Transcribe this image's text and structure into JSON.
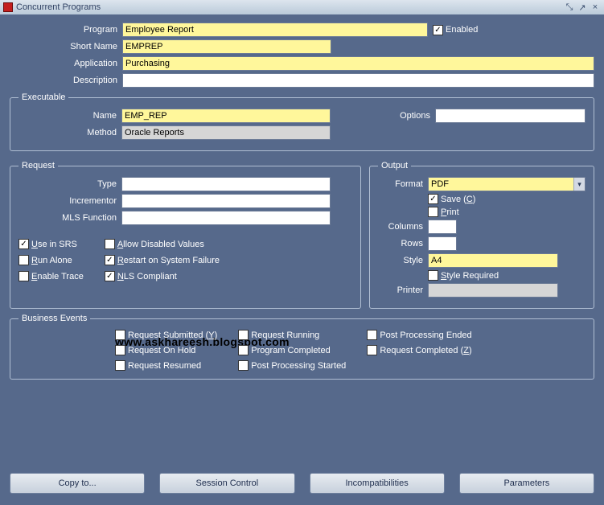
{
  "window": {
    "title": "Concurrent Programs"
  },
  "labels": {
    "program": "Program",
    "short_name": "Short Name",
    "application": "Application",
    "description": "Description",
    "enabled": "Enabled"
  },
  "program": {
    "name": "Employee Report",
    "short_name": "EMPREP",
    "application": "Purchasing",
    "description": "",
    "enabled": true
  },
  "executable": {
    "legend": "Executable",
    "labels": {
      "name": "Name",
      "method": "Method",
      "options": "Options"
    },
    "name": "EMP_REP",
    "method": "Oracle Reports",
    "options": ""
  },
  "request": {
    "legend": "Request",
    "labels": {
      "type": "Type",
      "incrementor": "Incrementor",
      "mls": "MLS Function"
    },
    "type": "",
    "incrementor": "",
    "mls": "",
    "checks": {
      "use_in_srs": {
        "label_pre": "U",
        "label": "se in SRS",
        "checked": true
      },
      "run_alone": {
        "label_pre": "R",
        "label": "un Alone",
        "checked": false
      },
      "enable_trace": {
        "label_pre": "E",
        "label": "nable Trace",
        "checked": false
      },
      "allow_disabled": {
        "label_pre": "A",
        "label": "llow Disabled Values",
        "checked": false
      },
      "restart": {
        "label_pre": "R",
        "label": "estart on System Failure",
        "checked": true
      },
      "nls": {
        "label_pre": "N",
        "label": "LS Compliant",
        "checked": true
      }
    }
  },
  "output": {
    "legend": "Output",
    "labels": {
      "format": "Format",
      "columns": "Columns",
      "rows": "Rows",
      "style": "Style",
      "printer": "Printer"
    },
    "format": "PDF",
    "save_label_pre": "Save (",
    "save_label_u": "C",
    "save_label_post": ")",
    "save": true,
    "print_pre": "P",
    "print_label": "rint",
    "print": false,
    "columns": "",
    "rows": "",
    "style": "A4",
    "style_required_pre": "S",
    "style_required_label": "tyle Required",
    "style_required": false,
    "printer": ""
  },
  "biz": {
    "legend": "Business Events",
    "items": {
      "submitted": {
        "label": "Request Submitted (",
        "u": "Y",
        "post": ")",
        "checked": false
      },
      "onhold": {
        "label": "Request On Hold",
        "checked": false
      },
      "resumed": {
        "label": "Request Resumed",
        "checked": false
      },
      "running": {
        "label": "Request Running",
        "checked": false
      },
      "prog_completed": {
        "label": "Program Completed",
        "checked": false
      },
      "post_started": {
        "label": "Post Processing Started",
        "checked": false
      },
      "post_ended": {
        "label": "Post Processing Ended",
        "checked": false
      },
      "req_completed": {
        "label": "Request Completed (",
        "u": "Z",
        "post": ")",
        "checked": false
      }
    }
  },
  "buttons": {
    "copy": "Copy to...",
    "session": "Session Control",
    "incomp": "Incompatibilities",
    "params": "Parameters"
  },
  "watermark": "www.askhareesh.blogspot.com"
}
